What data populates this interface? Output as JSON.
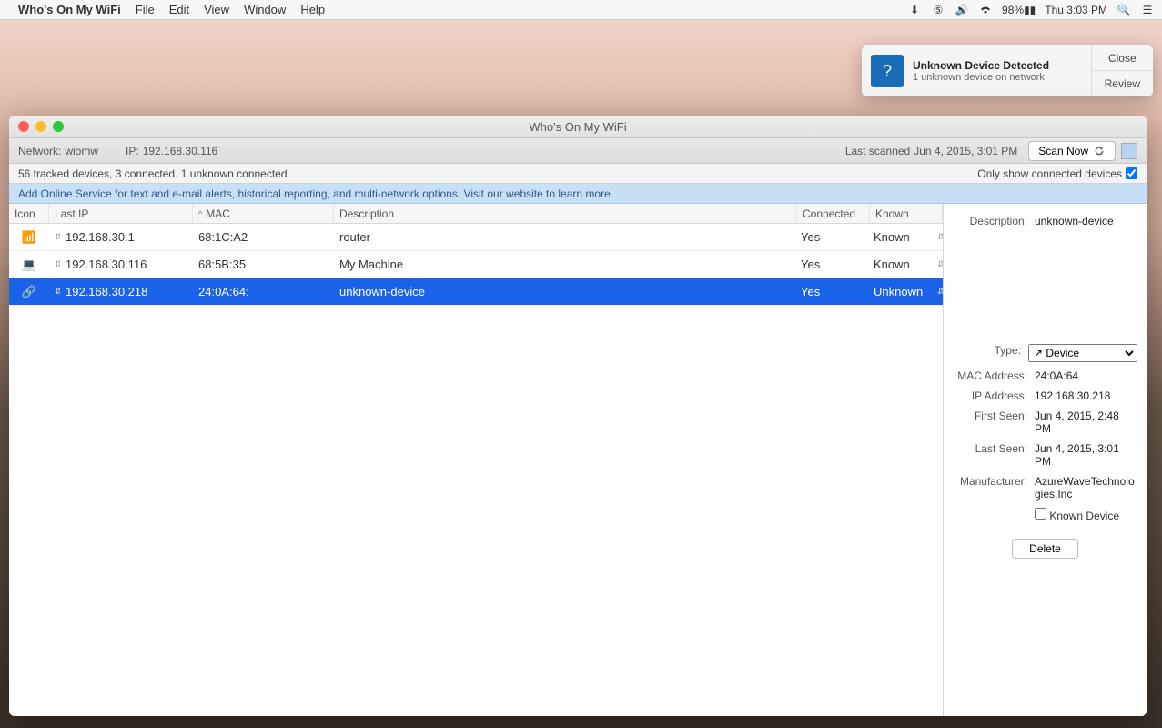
{
  "menubar": {
    "app_name": "Who's On My WiFi",
    "items": [
      "File",
      "Edit",
      "View",
      "Window",
      "Help"
    ],
    "battery": "98%",
    "clock": "Thu 3:03 PM"
  },
  "notification": {
    "title": "Unknown Device Detected",
    "subtitle": "1 unknown device on network",
    "close": "Close",
    "review": "Review"
  },
  "window": {
    "title": "Who's On My WiFi"
  },
  "toolbar": {
    "network_label": "Network:",
    "network_value": "wiomw",
    "ip_label": "IP:",
    "ip_value": "192.168.30.116",
    "last_scanned_label": "Last scanned",
    "last_scanned_value": "Jun 4, 2015, 3:01 PM",
    "scan_now": "Scan Now"
  },
  "statusbar": {
    "summary": "56 tracked devices, 3 connected. 1 unknown connected",
    "filter_label": "Only show connected devices"
  },
  "banner": {
    "text": "Add Online Service for text and e-mail alerts, historical reporting, and multi-network options.  Visit our website to learn more."
  },
  "table": {
    "headers": {
      "icon": "Icon",
      "ip": "Last IP",
      "mac": "MAC",
      "desc": "Description",
      "conn": "Connected",
      "known": "Known"
    },
    "rows": [
      {
        "icon": "wifi",
        "ip": "192.168.30.1",
        "mac": "68:1C:A2",
        "desc": "router",
        "conn": "Yes",
        "known": "Known",
        "selected": false
      },
      {
        "icon": "laptop",
        "ip": "192.168.30.116",
        "mac": "68:5B:35",
        "desc": "My Machine",
        "conn": "Yes",
        "known": "Known",
        "selected": false
      },
      {
        "icon": "device",
        "ip": "192.168.30.218",
        "mac": "24:0A:64:",
        "desc": "unknown-device",
        "conn": "Yes",
        "known": "Unknown",
        "selected": true
      }
    ]
  },
  "details": {
    "description_label": "Description:",
    "description_value": "unknown-device",
    "type_label": "Type:",
    "type_value": "Device",
    "mac_label": "MAC Address:",
    "mac_value": "24:0A:64",
    "ip_label": "IP Address:",
    "ip_value": "192.168.30.218",
    "first_seen_label": "First Seen:",
    "first_seen_value": "Jun 4, 2015, 2:48 PM",
    "last_seen_label": "Last Seen:",
    "last_seen_value": "Jun 4, 2015, 3:01 PM",
    "manufacturer_label": "Manufacturer:",
    "manufacturer_value": "AzureWaveTechnologies,Inc",
    "known_checkbox": "Known Device",
    "delete": "Delete"
  }
}
